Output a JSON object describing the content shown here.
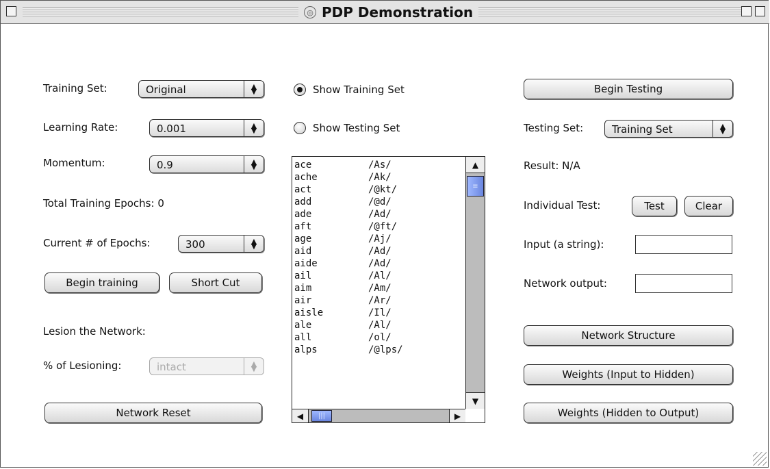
{
  "window": {
    "title": "PDP Demonstration"
  },
  "left": {
    "training_set_label": "Training Set:",
    "training_set_value": "Original",
    "learning_rate_label": "Learning Rate:",
    "learning_rate_value": "0.001",
    "momentum_label": "Momentum:",
    "momentum_value": "0.9",
    "total_epochs": "Total Training Epochs:  0",
    "current_epochs_label": "Current # of Epochs:",
    "current_epochs_value": "300",
    "begin_training": "Begin training",
    "short_cut": "Short Cut",
    "lesion_label": "Lesion the Network:",
    "lesioning_label": "% of Lesioning:",
    "lesioning_value": "intact",
    "network_reset": "Network Reset"
  },
  "middle": {
    "show_training": "Show Training Set",
    "show_testing": "Show Testing Set",
    "show_training_selected": true,
    "list": [
      {
        "word": "ace",
        "phon": "/As/"
      },
      {
        "word": "ache",
        "phon": "/Ak/"
      },
      {
        "word": "act",
        "phon": "/@kt/"
      },
      {
        "word": "add",
        "phon": "/@d/"
      },
      {
        "word": "ade",
        "phon": "/Ad/"
      },
      {
        "word": "aft",
        "phon": "/@ft/"
      },
      {
        "word": "age",
        "phon": "/Aj/"
      },
      {
        "word": "aid",
        "phon": "/Ad/"
      },
      {
        "word": "aide",
        "phon": "/Ad/"
      },
      {
        "word": "ail",
        "phon": "/Al/"
      },
      {
        "word": "aim",
        "phon": "/Am/"
      },
      {
        "word": "air",
        "phon": "/Ar/"
      },
      {
        "word": "aisle",
        "phon": "/Il/"
      },
      {
        "word": "ale",
        "phon": "/Al/"
      },
      {
        "word": "all",
        "phon": "/ol/"
      },
      {
        "word": "alps",
        "phon": "/@lps/"
      }
    ]
  },
  "right": {
    "begin_testing": "Begin Testing",
    "testing_set_label": "Testing Set:",
    "testing_set_value": "Training Set",
    "result": "Result: N/A",
    "individual_test_label": "Individual Test:",
    "test_button": "Test",
    "clear_button": "Clear",
    "input_label": "Input (a string):",
    "input_value": "",
    "output_label": "Network output:",
    "output_value": "",
    "network_structure": "Network Structure",
    "weights_input_hidden": "Weights (Input to Hidden)",
    "weights_hidden_output": "Weights (Hidden to Output)"
  }
}
